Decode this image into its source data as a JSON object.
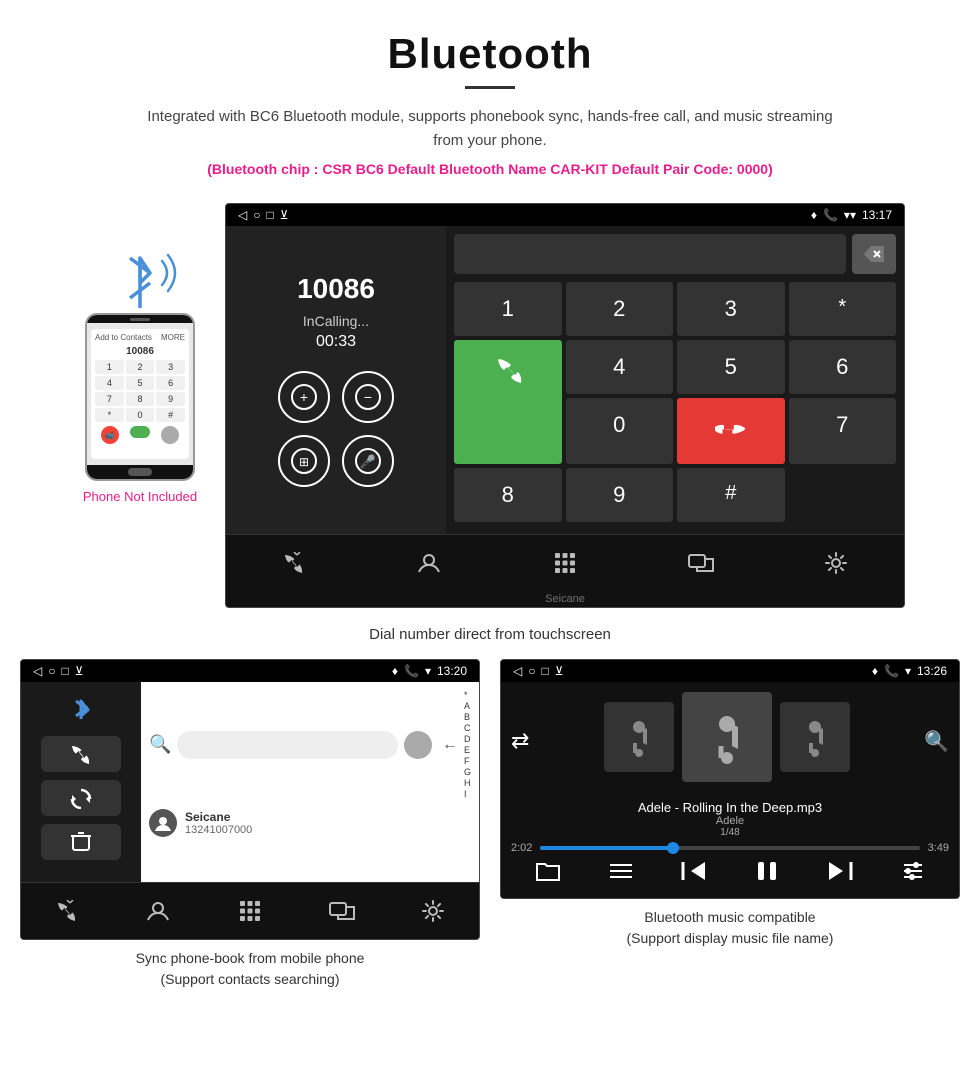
{
  "header": {
    "title": "Bluetooth",
    "description": "Integrated with BC6 Bluetooth module, supports phonebook sync, hands-free call, and music streaming from your phone.",
    "specs": "(Bluetooth chip : CSR BC6    Default Bluetooth Name CAR-KIT    Default Pair Code: 0000)"
  },
  "phone_sidebar": {
    "not_included_label": "Phone Not Included"
  },
  "car_screen_1": {
    "status_bar": {
      "back": "◁",
      "circle": "○",
      "square": "□",
      "download": "⬇",
      "location": "📍",
      "phone": "📞",
      "wifi": "▼",
      "time": "13:17"
    },
    "call": {
      "number": "10086",
      "status": "InCalling...",
      "timer": "00:33"
    },
    "dialpad": {
      "keys": [
        "1",
        "2",
        "3",
        "*",
        "4",
        "5",
        "6",
        "0",
        "7",
        "8",
        "9",
        "#"
      ],
      "call_btn": "📞",
      "end_btn": "📞"
    },
    "watermark": "Seicane"
  },
  "caption_1": "Dial number direct from touchscreen",
  "phonebook_screen": {
    "status_bar": {
      "time": "13:20"
    },
    "contact": {
      "name": "Seicane",
      "number": "13241007000"
    },
    "alpha_list": [
      "*",
      "A",
      "B",
      "C",
      "D",
      "E",
      "F",
      "G",
      "H",
      "I"
    ]
  },
  "caption_2": "Sync phone-book from mobile phone\n(Support contacts searching)",
  "music_screen": {
    "status_bar": {
      "time": "13:26"
    },
    "track": {
      "title": "Adele - Rolling In the Deep.mp3",
      "artist": "Adele",
      "count": "1/48"
    },
    "time_current": "2:02",
    "time_total": "3:49",
    "progress_percent": 35
  },
  "caption_3": "Bluetooth music compatible\n(Support display music file name)"
}
